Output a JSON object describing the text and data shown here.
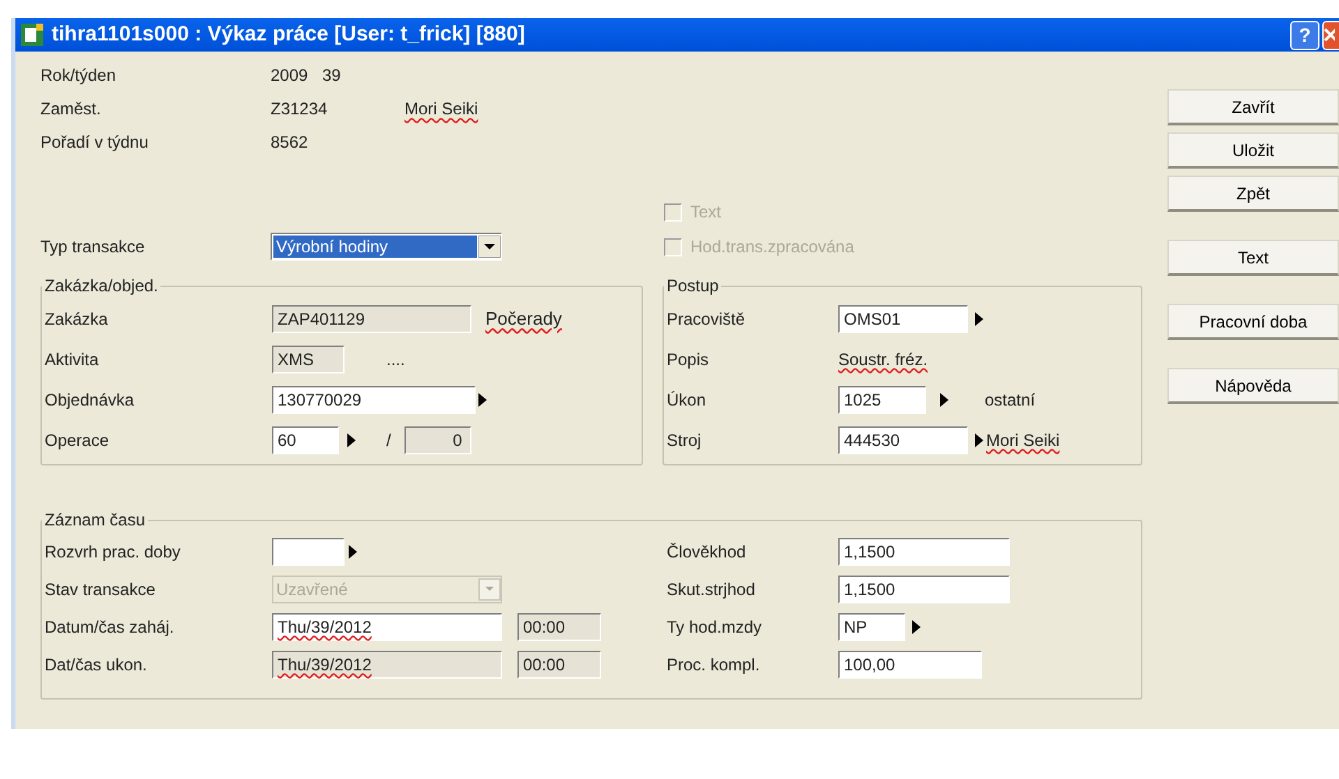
{
  "window": {
    "title": "tihra1101s000 : Výkaz práce [User: t_frick] [880]",
    "help": "?"
  },
  "header": {
    "rok_tyden": {
      "label": "Rok/týden",
      "year": "2009",
      "week": "39"
    },
    "zamest": {
      "label": "Zaměst.",
      "code": "Z31234",
      "name": "Mori Seiki",
      "misspelled": true
    },
    "poradi": {
      "label": "Pořadí v týdnu",
      "value": "8562"
    }
  },
  "checkboxes": [
    {
      "label": "Text",
      "checked": false,
      "disabled": true
    },
    {
      "label": "Hod.trans.zpracována",
      "checked": false,
      "disabled": true
    }
  ],
  "typ_transakce": {
    "label": "Typ transakce",
    "value": "Výrobní hodiny",
    "selected": true
  },
  "zakazka_group": {
    "title": "Zakázka/objed.",
    "zakazka": {
      "label": "Zakázka",
      "field": {
        "value": "ZAP401129",
        "readonly": true
      },
      "name": "Počerady",
      "misspelled": true
    },
    "aktivita": {
      "label": "Aktivita",
      "field": {
        "value": "XMS",
        "readonly": true
      },
      "extra": "...."
    },
    "objednavka": {
      "label": "Objednávka",
      "field": {
        "value": "130770029",
        "readonly": false
      }
    },
    "operace": {
      "label": "Operace",
      "field": {
        "value": "60",
        "readonly": false
      },
      "separator": "/",
      "sub": {
        "value": "0",
        "readonly": true
      }
    }
  },
  "postup": {
    "title": "Postup",
    "pracoviste": {
      "label": "Pracoviště",
      "field": {
        "value": "OMS01",
        "readonly": false
      }
    },
    "popis": {
      "label": "Popis",
      "value": "Soustr. fréz.",
      "misspelled": true
    },
    "ukon": {
      "label": "Úkon",
      "field": {
        "value": "1025",
        "readonly": false
      },
      "name": "ostatní",
      "misspelled": false
    },
    "stroj": {
      "label": "Stroj",
      "field": {
        "value": "444530",
        "readonly": false
      },
      "name": "Mori Seiki",
      "misspelled": true
    }
  },
  "zaznam": {
    "title": "Záznam času",
    "rozvrh": {
      "label": "Rozvrh prac. doby",
      "field": {
        "readonly": false
      }
    },
    "stav": {
      "label": "Stav transakce",
      "value": "Uzavřené",
      "disabled": true
    },
    "zahaj": {
      "label": "Datum/čas zaháj.",
      "date": {
        "value": "Thu/39/2012",
        "readonly": false,
        "misspelled": true
      },
      "time": {
        "value": "00:00",
        "readonly": true
      }
    },
    "konec": {
      "label": "Dat/čas ukon.",
      "date": {
        "value": "Thu/39/2012",
        "readonly": true,
        "misspelled": true
      },
      "time": {
        "value": "00:00",
        "readonly": true
      }
    },
    "clovekhod": {
      "label": "Člověkhod",
      "field": {
        "value": "1,1500",
        "readonly": false
      }
    },
    "skut": {
      "label": "Skut.strjhod",
      "field": {
        "value": "1,1500",
        "readonly": false
      }
    },
    "ty_hod": {
      "label": "Ty hod.mzdy",
      "field": {
        "value": "NP",
        "readonly": false
      }
    },
    "proc": {
      "label": "Proc. kompl.",
      "field": {
        "value": "100,00",
        "readonly": false
      }
    }
  },
  "button_groups": [
    [
      "Zavřít",
      "Uložit",
      "Zpět"
    ],
    [
      "Text"
    ],
    [
      "Pracovní doba"
    ],
    [
      "Nápověda"
    ]
  ]
}
